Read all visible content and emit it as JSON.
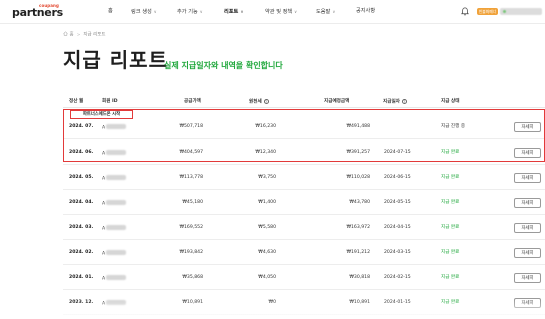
{
  "header": {
    "logo_small": "coupang",
    "logo_big": "partners",
    "nav": [
      {
        "label": "홈",
        "chevron": ""
      },
      {
        "label": "링크 생성",
        "chevron": "∨"
      },
      {
        "label": "추가 기능",
        "chevron": "∨"
      },
      {
        "label": "리포트",
        "chevron": "∨"
      },
      {
        "label": "약관 및 정책",
        "chevron": "∨"
      },
      {
        "label": "도움말",
        "chevron": "∨"
      },
      {
        "label": "공지사항",
        "chevron": ""
      }
    ],
    "user_badge": "빈불화폐너"
  },
  "breadcrumb": {
    "home": "홈",
    "current": "지급 리포트"
  },
  "page": {
    "title": "지급 리포트",
    "subtitle": "실제 지급일자와 내역을 확인합니다",
    "tag": "파트너스에드온 시작"
  },
  "table": {
    "headers": {
      "month": "정산 월",
      "member_id": "회원 ID",
      "supply": "공급가액",
      "wht": "원천세",
      "pay_amount": "지급예정금액",
      "pay_date": "지급일자",
      "status": "지급 상태"
    },
    "detail_label": "자세히",
    "rows": [
      {
        "month": "2024. 07.",
        "member": "A",
        "supply": "₩507,718",
        "wht": "₩16,230",
        "pay": "₩491,488",
        "date": "",
        "status": "지급 진행 중",
        "status_color": "#333333"
      },
      {
        "month": "2024. 06.",
        "member": "A",
        "supply": "₩404,597",
        "wht": "₩12,340",
        "pay": "₩391,257",
        "date": "2024-07-15",
        "status": "지급 완료",
        "status_color": "#1fa73b"
      },
      {
        "month": "2024. 05.",
        "member": "A",
        "supply": "₩113,778",
        "wht": "₩3,750",
        "pay": "₩110,028",
        "date": "2024-06-15",
        "status": "지급 완료",
        "status_color": "#1fa73b"
      },
      {
        "month": "2024. 04.",
        "member": "A",
        "supply": "₩45,180",
        "wht": "₩1,400",
        "pay": "₩43,780",
        "date": "2024-05-15",
        "status": "지급 완료",
        "status_color": "#1fa73b"
      },
      {
        "month": "2024. 03.",
        "member": "A",
        "supply": "₩169,552",
        "wht": "₩5,580",
        "pay": "₩163,972",
        "date": "2024-04-15",
        "status": "지급 완료",
        "status_color": "#1fa73b"
      },
      {
        "month": "2024. 02.",
        "member": "A",
        "supply": "₩193,842",
        "wht": "₩4,630",
        "pay": "₩191,212",
        "date": "2024-03-15",
        "status": "지급 완료",
        "status_color": "#1fa73b"
      },
      {
        "month": "2024. 01.",
        "member": "A",
        "supply": "₩35,868",
        "wht": "₩4,050",
        "pay": "₩30,818",
        "date": "2024-02-15",
        "status": "지급 완료",
        "status_color": "#1fa73b"
      },
      {
        "month": "2023. 12.",
        "member": "A",
        "supply": "₩10,891",
        "wht": "₩0",
        "pay": "₩10,891",
        "date": "2024-01-15",
        "status": "지급 완료",
        "status_color": "#1fa73b"
      }
    ]
  },
  "colors": {
    "accent_green": "#1fa73b",
    "highlight_red": "#e23a3a",
    "badge_orange": "#f0a23a"
  },
  "icons": {
    "bell": "bell-icon",
    "home": "home-icon",
    "info": "info-icon"
  }
}
